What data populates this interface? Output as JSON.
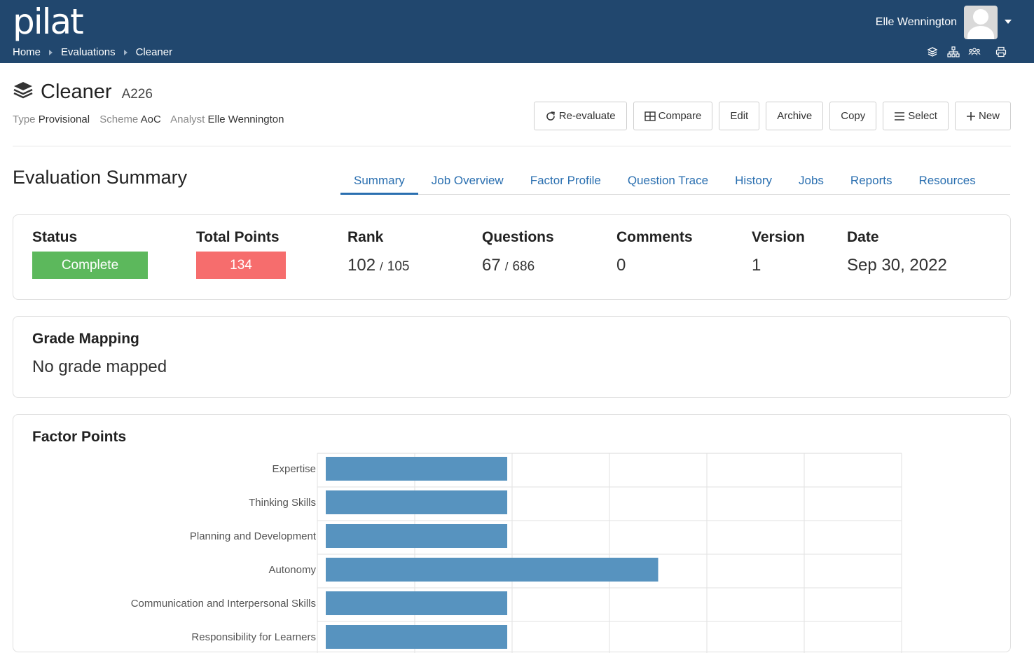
{
  "app": {
    "logo": "pilat"
  },
  "breadcrumb": [
    "Home",
    "Evaluations",
    "Cleaner"
  ],
  "user": {
    "name": "Elle Wennington"
  },
  "header": {
    "title": "Cleaner",
    "code": "A226",
    "type_label": "Type",
    "type_value": "Provisional",
    "scheme_label": "Scheme",
    "scheme_value": "AoC",
    "analyst_label": "Analyst",
    "analyst_value": "Elle Wennington"
  },
  "actions": {
    "reevaluate": "Re-evaluate",
    "compare": "Compare",
    "edit": "Edit",
    "archive": "Archive",
    "copy": "Copy",
    "select": "Select",
    "new": "New"
  },
  "section_title": "Evaluation Summary",
  "tabs": [
    "Summary",
    "Job Overview",
    "Factor Profile",
    "Question Trace",
    "History",
    "Jobs",
    "Reports",
    "Resources"
  ],
  "stats": {
    "status": {
      "label": "Status",
      "value": "Complete",
      "color": "#5cb85c"
    },
    "points": {
      "label": "Total Points",
      "value": "134",
      "color": "#f66d6d"
    },
    "rank": {
      "label": "Rank",
      "value": "102",
      "of": "105"
    },
    "questions": {
      "label": "Questions",
      "value": "67",
      "of": "686"
    },
    "comments": {
      "label": "Comments",
      "value": "0"
    },
    "version": {
      "label": "Version",
      "value": "1"
    },
    "date": {
      "label": "Date",
      "value": "Sep 30, 2022"
    }
  },
  "grade": {
    "title": "Grade Mapping",
    "value": "No grade mapped"
  },
  "factor": {
    "title": "Factor Points"
  },
  "chart_data": {
    "type": "bar",
    "orientation": "horizontal",
    "categories": [
      "Expertise",
      "Thinking Skills",
      "Planning and Development",
      "Autonomy",
      "Communication and Interpersonal Skills",
      "Responsibility for Learners"
    ],
    "values": [
      19.5,
      19.5,
      19.5,
      35,
      19.5,
      19.5
    ],
    "xlim": [
      0,
      60
    ],
    "grid": true,
    "color": "#5793bf"
  }
}
